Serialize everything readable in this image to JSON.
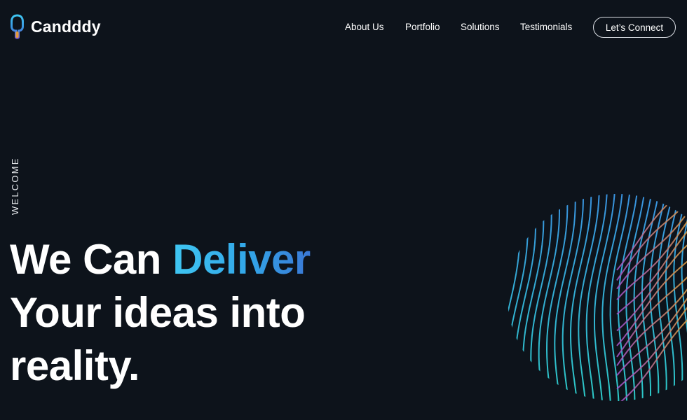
{
  "brand": {
    "name": "Candddy",
    "icon": "candy-pin-icon"
  },
  "nav": {
    "links": [
      "About Us",
      "Portfolio",
      "Solutions",
      "Testimonials"
    ],
    "cta": "Let’s Connect"
  },
  "hero": {
    "eyebrow": "WELCOME",
    "line1": "We Can ",
    "highlight": "Deliver",
    "line2": "Your ideas into",
    "line3": "reality."
  },
  "colors": {
    "background": "#0d131b",
    "accent_start": "#3fc6f2",
    "accent_end": "#3a78d6",
    "wave_cyan": "#2bd0c4",
    "wave_blue": "#3a8fe0",
    "wave_purple": "#a050c8",
    "wave_orange": "#d89a3c"
  },
  "decorations": {
    "hero_art": "wavy-lines-graphic"
  }
}
